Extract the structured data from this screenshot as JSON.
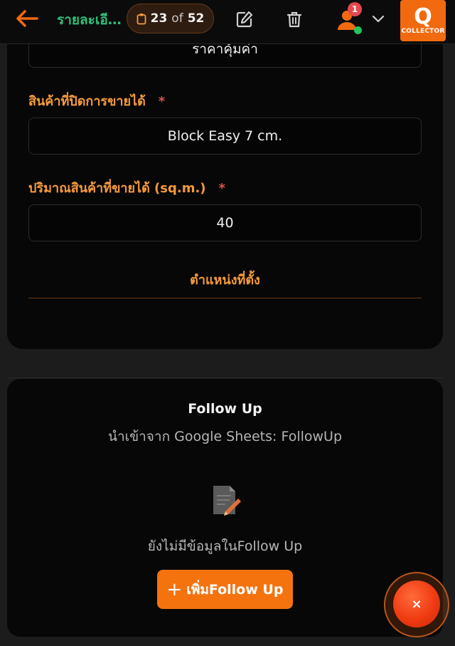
{
  "header": {
    "title": "รายละเอี...",
    "counter_current": "23",
    "counter_of": "of",
    "counter_total": "52",
    "notification_count": "1",
    "logo_text": "COLLECTOR",
    "logo_letter": "Q",
    "accent_color": "#f26a10",
    "icons": [
      "back-arrow-icon",
      "clipboard-icon",
      "edit-icon",
      "trash-icon",
      "user-icon",
      "chevron-down-icon"
    ]
  },
  "form": {
    "top_value": "ราคาคุ้มค่า",
    "product_label": "สินค้าที่ปิดการขายได้",
    "product_value": "Block Easy 7 cm.",
    "quantity_label": "ปริมาณสินค้าที่ขายได้ (sq.m.)",
    "quantity_value": "40",
    "required_mark": "*",
    "location_section": "ตำแหน่งที่ตั้ง"
  },
  "followup": {
    "title": "Follow Up",
    "subtitle": "นำเข้าจาก Google Sheets: FollowUp",
    "empty_text": "ยังไม่มีข้อมูลในFollow Up",
    "add_button": "เพิ่มFollow Up",
    "add_icon": "+",
    "empty_icon": "document-edit-icon"
  },
  "fab": {
    "close_icon": "×"
  }
}
